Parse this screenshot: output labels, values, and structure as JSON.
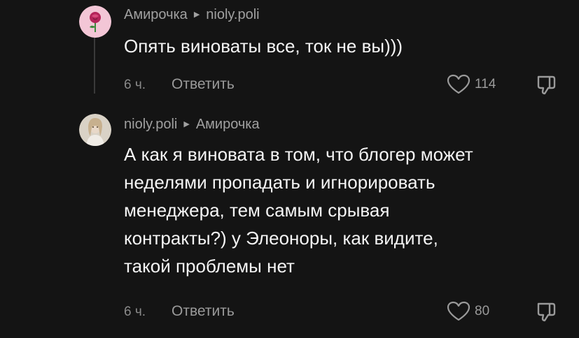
{
  "comments": [
    {
      "author": "Амирочка",
      "reply_to": "nioly.poli",
      "text_lines": [
        "Опять виноваты все, ток не вы)))"
      ],
      "time": "6 ч.",
      "reply_label": "Ответить",
      "likes": "114",
      "avatar_icon": "rose-icon"
    },
    {
      "author": "nioly.poli",
      "reply_to": "Амирочка",
      "text_lines": [
        "А как я виновата в том, что блогер может",
        "неделями пропадать и игнорировать",
        "менеджера, тем самым срывая",
        "контракты?) у Элеоноры, как видите,",
        "такой проблемы нет"
      ],
      "time": "6 ч.",
      "reply_label": "Ответить",
      "likes": "80",
      "avatar_icon": "photo-avatar"
    }
  ],
  "colors": {
    "background": "#141414",
    "text": "#f4f4f4",
    "secondary_text": "#a0a0a0",
    "avatar_pink_bg": "#f3c6d6",
    "rose": "#b4245a"
  }
}
